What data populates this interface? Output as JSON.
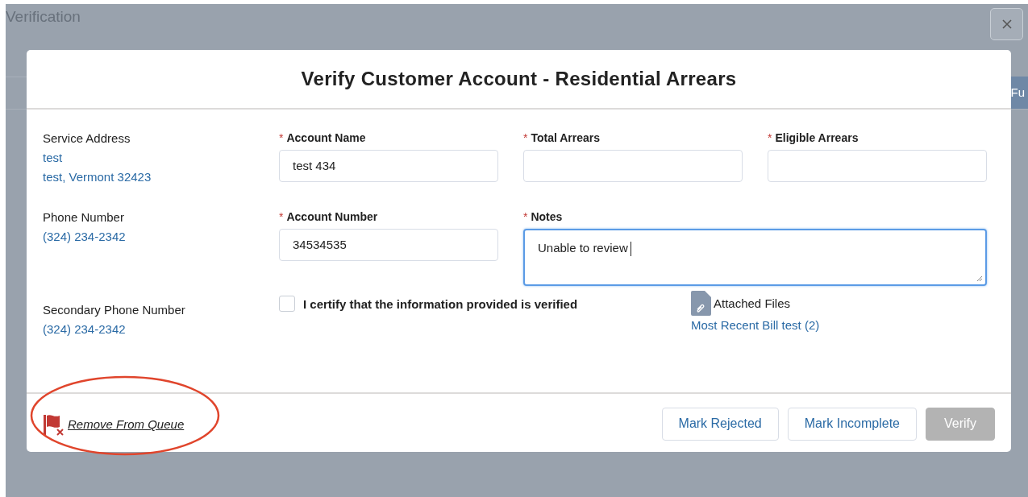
{
  "page": {
    "title": "Verification",
    "background_button": "Fu"
  },
  "modal": {
    "title": "Verify Customer Account - Residential Arrears"
  },
  "details": [
    {
      "label": "Service Address",
      "lines": [
        "test",
        "test, Vermont 32423"
      ]
    },
    {
      "label": "Phone Number",
      "lines": [
        "(324) 234-2342"
      ]
    },
    {
      "label": "Secondary Phone Number",
      "lines": [
        "(324) 234-2342"
      ]
    }
  ],
  "fields": [
    {
      "label": "Account Name",
      "required_mark": "*",
      "value": "test 434",
      "kind": "text",
      "focused": false
    },
    {
      "label": "Total Arrears",
      "required_mark": "*",
      "kind": "text",
      "focused": false
    },
    {
      "label": "Eligible Arrears",
      "required_mark": "*",
      "kind": "text",
      "focused": false
    },
    {
      "label": "Account Number",
      "required_mark": "*",
      "value": "34534535",
      "kind": "text",
      "focused": false
    },
    {
      "label": "Notes",
      "required_mark": "*",
      "value": "Unable to review",
      "kind": "textarea",
      "focused": true
    }
  ],
  "certify": {
    "label": "I certify that the information provided is verified",
    "checked": false
  },
  "attachments": {
    "label": "Attached Files",
    "files": [
      "Most Recent Bill test (2)"
    ]
  },
  "footer": {
    "remove_link": "Remove From Queue",
    "annotation_circled": true,
    "buttons": [
      {
        "label": "Mark Rejected",
        "disabled": false
      },
      {
        "label": "Mark Incomplete",
        "disabled": false
      },
      {
        "label": "Verify",
        "disabled": true
      }
    ]
  }
}
